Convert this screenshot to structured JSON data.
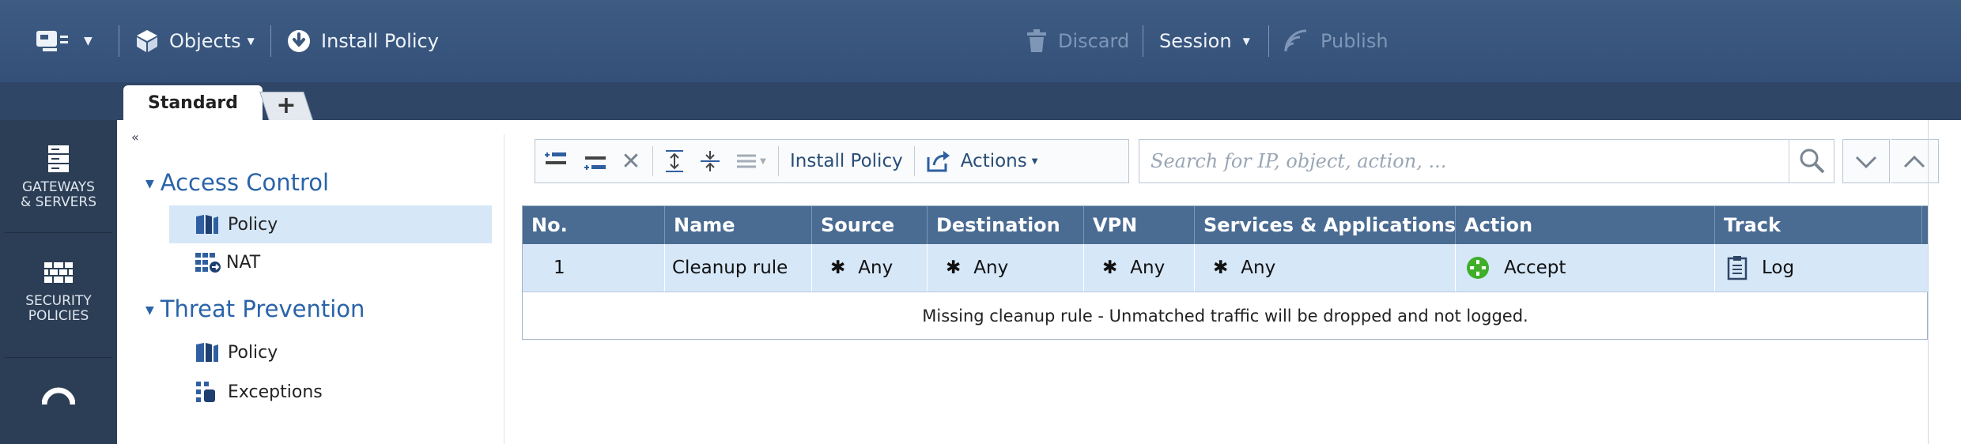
{
  "topbar": {
    "objects_label": "Objects",
    "install_policy_label": "Install Policy",
    "discard_label": "Discard",
    "session_label": "Session",
    "publish_label": "Publish"
  },
  "tabs": {
    "active_label": "Standard",
    "add_label": "+"
  },
  "sidenav": {
    "gateways_label_1": "GATEWAYS",
    "gateways_label_2": "& SERVERS",
    "security_label_1": "SECURITY",
    "security_label_2": "POLICIES"
  },
  "tree": {
    "collapse_glyph": "«",
    "access_control": "Access Control",
    "access_policy": "Policy",
    "nat": "NAT",
    "threat_prevention": "Threat Prevention",
    "threat_policy": "Policy",
    "exceptions": "Exceptions"
  },
  "toolbar": {
    "install_policy_label": "Install Policy",
    "actions_label": "Actions"
  },
  "search": {
    "placeholder": "Search for IP, object, action, ..."
  },
  "table": {
    "columns": [
      "No.",
      "Name",
      "Source",
      "Destination",
      "VPN",
      "Services & Applications",
      "Action",
      "Track"
    ],
    "rows": [
      {
        "no": "1",
        "name": "Cleanup rule",
        "source": "Any",
        "destination": "Any",
        "vpn": "Any",
        "services": "Any",
        "action": "Accept",
        "track": "Log"
      }
    ],
    "message": "Missing cleanup rule - Unmatched traffic will be dropped and not logged."
  },
  "colors": {
    "topbar_bg": "#3a587e",
    "grid_header_bg": "#4a6c93",
    "selected_row_bg": "#d6e7f8",
    "accept_green": "#3fae29",
    "link_blue": "#2a63a9"
  }
}
